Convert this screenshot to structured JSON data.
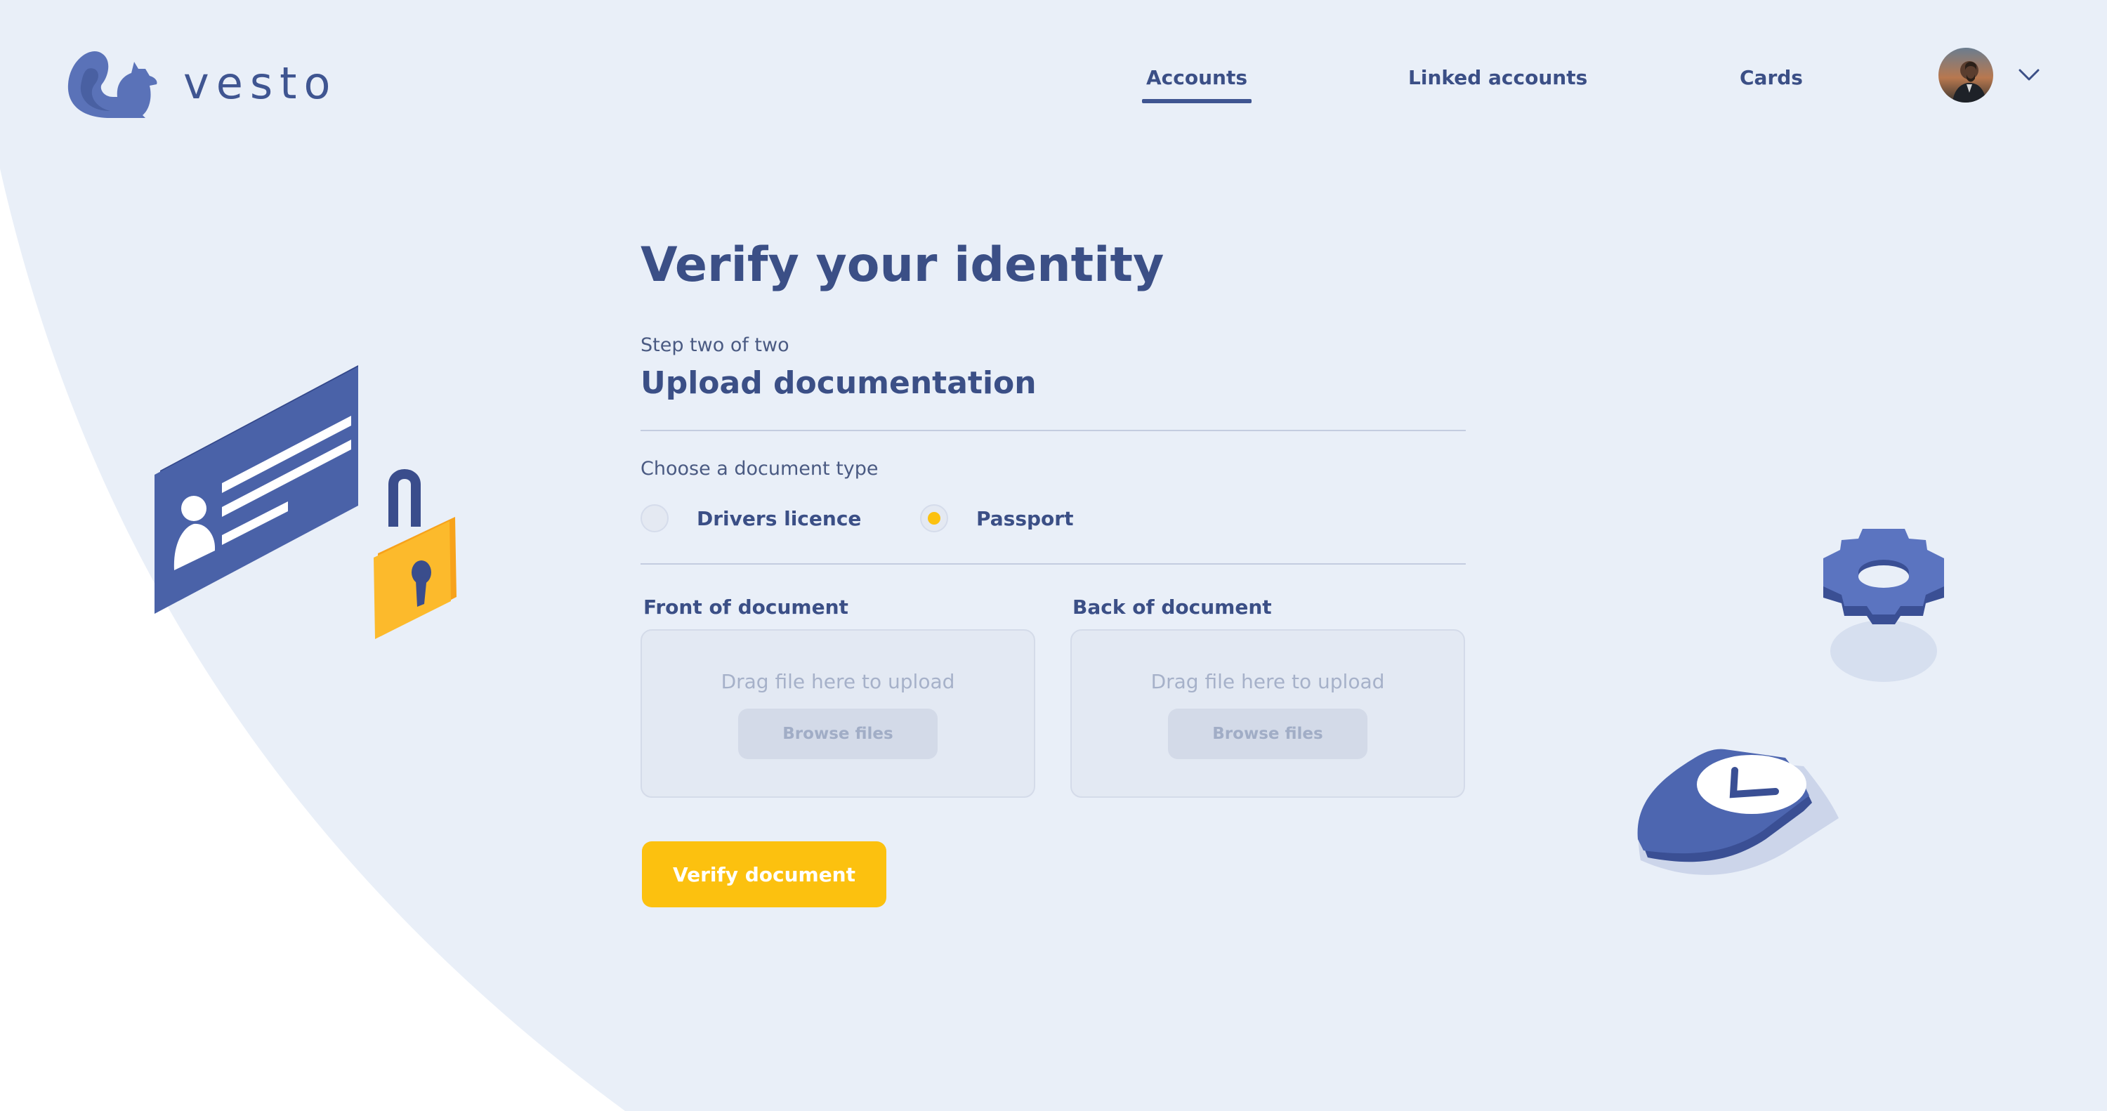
{
  "brand": {
    "name": "vesto"
  },
  "nav": {
    "items": [
      {
        "label": "Accounts",
        "active": true
      },
      {
        "label": "Linked accounts",
        "active": false
      },
      {
        "label": "Cards",
        "active": false
      }
    ]
  },
  "user_menu": {
    "icon": "chevron-down-icon"
  },
  "main": {
    "title": "Verify your identity",
    "step": "Step two of two",
    "subtitle": "Upload documentation",
    "doc_type_label": "Choose a document type",
    "options": [
      {
        "label": "Drivers licence",
        "selected": false
      },
      {
        "label": "Passport",
        "selected": true
      }
    ],
    "front": {
      "label": "Front of document",
      "drop_text": "Drag file here to upload",
      "browse": "Browse files"
    },
    "back": {
      "label": "Back of document",
      "drop_text": "Drag file here to upload",
      "browse": "Browse files"
    },
    "verify_button": "Verify document"
  },
  "colors": {
    "background": "#e9eff8",
    "primary": "#3f5591",
    "accent": "#fcc10f"
  }
}
